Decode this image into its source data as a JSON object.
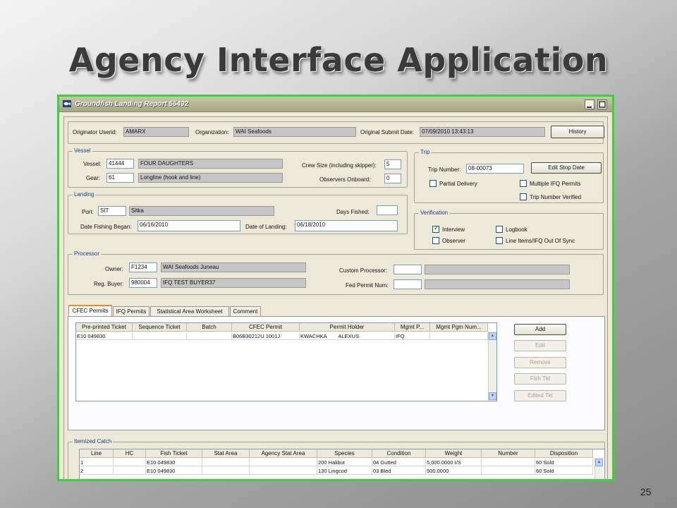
{
  "slide": {
    "title": "Agency Interface Application",
    "page_number": "25"
  },
  "window": {
    "title": "Groundfish Landing Report 55492",
    "accent": "#3cd23c"
  },
  "header": {
    "originator_label": "Originator Userid:",
    "originator_value": "AMARX",
    "organization_label": "Organization:",
    "organization_value": "WAI Seafoods",
    "submit_label": "Original Submit Date:",
    "submit_value": "07/09/2010 13:43:13",
    "history_button": "History"
  },
  "vessel": {
    "title": "Vessel",
    "vessel_label": "Vessel:",
    "vessel_id": "41444",
    "vessel_name": "FOUR DAUGHTERS",
    "gear_label": "Gear:",
    "gear_code": "61",
    "gear_name": "Longline (hook and line)",
    "crew_label": "Crew Size (including skipper):",
    "crew_value": "5",
    "observers_label": "Observers Onboard:",
    "observers_value": "0"
  },
  "trip": {
    "title": "Trip",
    "trip_number_label": "Trip Number:",
    "trip_number_value": "08-00073",
    "edit_stop_button": "Edit Stop Date",
    "partial_delivery": "Partial Delivery",
    "multiple_ifq": "Multiple IFQ Permits",
    "trip_verified": "Trip Number Verified"
  },
  "landing": {
    "title": "Landing",
    "port_label": "Port:",
    "port_code": "SIT",
    "port_name": "Sitka",
    "days_label": "Days Fished:",
    "days_value": "",
    "began_label": "Date Fishing Began:",
    "began_value": "06/16/2010",
    "landing_label": "Date of Landing:",
    "landing_value": "06/18/2010"
  },
  "verification": {
    "title": "Verification",
    "interview": "Interview",
    "logbook": "Logbook",
    "observer": "Observer",
    "line_items": "Line Items/IFQ Out Of Sync"
  },
  "processor": {
    "title": "Processor",
    "owner_label": "Owner:",
    "owner_code": "F1234",
    "owner_name": "WAI Seafoods Juneau",
    "buyer_label": "Reg. Buyer:",
    "buyer_code": "980004",
    "buyer_name": "IFQ TEST BUYER37",
    "custom_label": "Custom Processor:",
    "fed_label": "Fed Permit Num:"
  },
  "tabs": [
    "CFEC Permits",
    "IFQ Permits",
    "Statistical Area Worksheet",
    "Comment"
  ],
  "permits": {
    "columns": [
      "Pre-printed Ticket",
      "Sequence Ticket",
      "Batch",
      "CFEC Permit",
      "Permit Holder",
      "Mgmt P...",
      "Mgmt Pgm Num..."
    ],
    "rows": [
      [
        "E10 049830",
        "",
        "",
        "B06B30212U 1001J",
        "KWACHKA        ALEXUS",
        "IFQ",
        ""
      ]
    ],
    "buttons": {
      "add": "Add",
      "edit": "Edit",
      "remove": "Remove",
      "fish_tkt": "Fish Tkt",
      "edited_tkt": "Edited Tkt"
    }
  },
  "itemized": {
    "title": "Itemized Catch",
    "columns": [
      "Line",
      "HC",
      "Fish Ticket",
      "Stat Area",
      "Agency Stat Area",
      "Species",
      "Condition",
      "Weight",
      "Number",
      "Disposition"
    ],
    "rows": [
      [
        "1",
        "",
        "E10 049830",
        "",
        "",
        "200 Halibut",
        "04 Gutted",
        "5,000.0000 I/S",
        "",
        "60 Sold"
      ],
      [
        "2",
        "",
        "E10 049830",
        "",
        "",
        "130 Lingcod",
        "03 Bled",
        "500.0000",
        "",
        "60 Sold"
      ]
    ]
  }
}
